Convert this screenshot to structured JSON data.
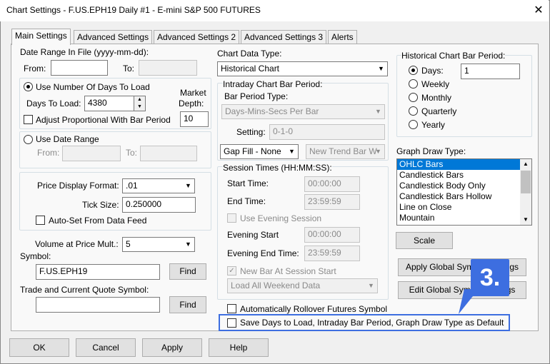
{
  "window": {
    "title": "Chart Settings - F.US.EPH19  Daily  #1 - E-mini S&P 500 FUTURES",
    "close": "✕"
  },
  "tabs": [
    "Main Settings",
    "Advanced Settings",
    "Advanced Settings 2",
    "Advanced Settings 3",
    "Alerts"
  ],
  "left": {
    "date_range_label": "Date Range In File (yyyy-mm-dd):",
    "from_label": "From:",
    "from_value": "",
    "to_label": "To:",
    "to_value": "",
    "use_days_label": "Use Number Of Days To Load",
    "days_to_load_label": "Days To Load:",
    "days_to_load_value": "4380",
    "market_depth_label_1": "Market",
    "market_depth_label_2": "Depth:",
    "market_depth_value": "10",
    "adjust_label": "Adjust Proportional With Bar Period",
    "use_date_range_label": "Use Date Range",
    "dr_from_label": "From:",
    "dr_to_label": "To:",
    "price_format_label": "Price Display Format:",
    "price_format_value": ".01",
    "tick_size_label": "Tick Size:",
    "tick_size_value": "0.250000",
    "autoset_label": "Auto-Set From Data Feed",
    "vap_label": "Volume at Price Mult.:",
    "vap_value": "5",
    "symbol_label": "Symbol:",
    "symbol_value": "F.US.EPH19",
    "find_label": "Find",
    "trade_symbol_label": "Trade and Current Quote Symbol:",
    "trade_symbol_value": "",
    "find2_label": "Find"
  },
  "middle": {
    "chart_data_type_label": "Chart Data Type:",
    "chart_data_type_value": "Historical Chart",
    "intraday_label": "Intraday Chart Bar Period:",
    "bar_period_type_label": "Bar Period Type:",
    "bar_period_type_value": "Days-Mins-Secs Per Bar",
    "setting_label": "Setting:",
    "setting_value": "0-1-0",
    "gap_fill_value": "Gap Fill - None",
    "new_trend_value": "New Trend Bar W",
    "session_label": "Session Times (HH:MM:SS):",
    "start_time_label": "Start Time:",
    "start_time_value": "00:00:00",
    "end_time_label": "End Time:",
    "end_time_value": "23:59:59",
    "use_evening_label": "Use Evening Session",
    "evening_start_label": "Evening Start",
    "evening_start_value": "00:00:00",
    "evening_end_label": "Evening End Time:",
    "evening_end_value": "23:59:59",
    "new_bar_label": "New Bar At Session Start",
    "load_weekend_value": "Load All Weekend Data",
    "auto_rollover_label": "Automatically Rollover Futures Symbol",
    "save_days_label": "Save Days to Load, Intraday Bar Period, Graph Draw Type as Default"
  },
  "right": {
    "hist_period_label": "Historical Chart Bar Period:",
    "periods": [
      "Days:",
      "Weekly",
      "Monthly",
      "Quarterly",
      "Yearly"
    ],
    "days_value": "1",
    "graph_draw_label": "Graph Draw Type:",
    "graph_types": [
      "OHLC Bars",
      "Candlestick Bars",
      "Candlestick Body Only",
      "Candlestick Bars Hollow",
      "Line on Close",
      "Mountain"
    ],
    "scale_label": "Scale",
    "apply_global_label": "Apply Global Symbol Settings",
    "edit_global_label": "Edit Global Symbol Settings"
  },
  "buttons": {
    "ok": "OK",
    "cancel": "Cancel",
    "apply": "Apply",
    "help": "Help"
  },
  "annotation": {
    "callout": "3.",
    "color": "#3d6ee0"
  }
}
